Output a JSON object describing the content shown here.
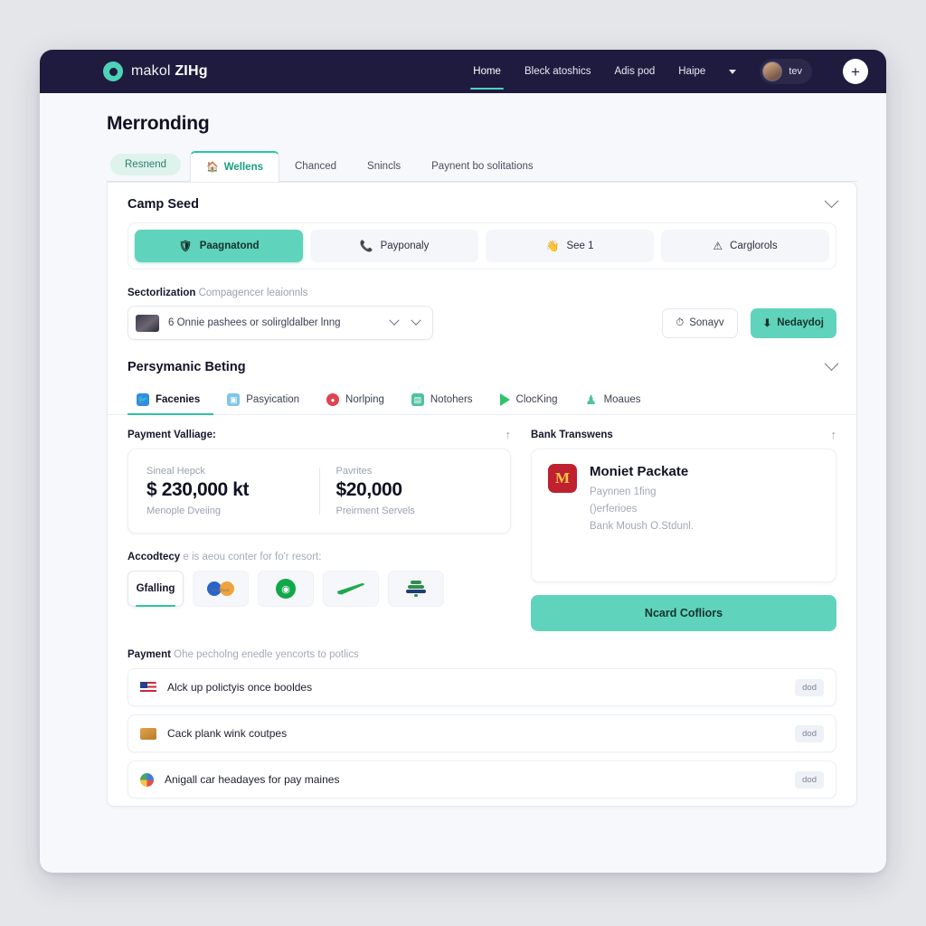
{
  "navbar": {
    "brand_light": "makol ",
    "brand_bold": "ZIHg",
    "links": [
      {
        "label": "Home",
        "active": true
      },
      {
        "label": "Bleck atoshics",
        "active": false
      },
      {
        "label": "Adis pod",
        "active": false
      },
      {
        "label": "Haipe",
        "active": false
      }
    ],
    "user_name": "tev",
    "add_label": "+"
  },
  "page": {
    "title": "Merronding",
    "pill_tab": "Resnend",
    "tabs": [
      {
        "label": "Wellens",
        "active": true
      },
      {
        "label": "Chanced",
        "active": false
      },
      {
        "label": "Snincls",
        "active": false
      },
      {
        "label": "Paynent bo solitations",
        "active": false
      }
    ]
  },
  "camp_section": {
    "title": "Camp Seed",
    "segments": [
      {
        "label": "Paagnatond",
        "icon": "shield-icon",
        "active": true
      },
      {
        "label": "Payponaly",
        "icon": "phone-icon",
        "active": false
      },
      {
        "label": "See 1",
        "icon": "hand-icon",
        "active": false
      },
      {
        "label": "Carglorols",
        "icon": "warning-icon",
        "active": false
      }
    ]
  },
  "sectorization": {
    "label": "Sectorlization",
    "hint": "Compagencer leaionnls",
    "select_value": "6 Onnie pashees or solirgldalber lnng",
    "buttons": [
      {
        "label": "Sonayv",
        "icon": "clock-icon",
        "style": "ghost"
      },
      {
        "label": "Nedaydoj",
        "icon": "download-icon",
        "style": "primary"
      }
    ]
  },
  "persymanic": {
    "title": "Persymanic Beting",
    "subtabs": [
      {
        "label": "Facenies",
        "icon": "twitter-icon",
        "color": "#2f8fe0",
        "shape": "square",
        "glyph": "✈",
        "active": true
      },
      {
        "label": "Pasyication",
        "icon": "photo-icon",
        "color": "#7ec6e8",
        "shape": "square",
        "glyph": "▣",
        "active": false
      },
      {
        "label": "Norlping",
        "icon": "record-icon",
        "color": "#e0434f",
        "shape": "circle",
        "glyph": "●",
        "active": false
      },
      {
        "label": "Notohers",
        "icon": "notes-icon",
        "color": "#4fc2a0",
        "shape": "square",
        "glyph": "▤",
        "active": false
      },
      {
        "label": "ClocKing",
        "icon": "play-icon",
        "color": "#2ec46d",
        "shape": "triangle",
        "glyph": "",
        "active": false
      },
      {
        "label": "Moaues",
        "icon": "person-icon",
        "color": "#4fc2a0",
        "shape": "person",
        "glyph": "♟",
        "active": false
      }
    ]
  },
  "payment_value": {
    "heading": "Payment Valliage:",
    "left": {
      "caption": "Sineal Hepck",
      "value": "$ 230,000 kt",
      "sub": "Menople Dveiing"
    },
    "right": {
      "caption": "Pavrites",
      "value": "$20,000",
      "sub": "Preirment Servels"
    }
  },
  "bank_transfer": {
    "heading": "Bank Transwens",
    "logo_letter": "M",
    "name": "Moniet Packate",
    "lines": [
      "Paynnen 1fing",
      "()erferioes",
      "Bank Moush O.Stdunl."
    ],
    "cta_label": "Ncard Cofliors"
  },
  "methods": {
    "label": "Accodtecy",
    "hint": "e is aeou conter for fo'r resort:",
    "items": [
      {
        "label": "Gfalling",
        "type": "text",
        "active": true
      },
      {
        "label": "",
        "type": "dual-circle-card",
        "caption": "bstdfous",
        "active": false
      },
      {
        "label": "",
        "type": "green-badge",
        "active": false
      },
      {
        "label": "",
        "type": "swoosh",
        "active": false
      },
      {
        "label": "",
        "type": "stack",
        "active": false
      }
    ]
  },
  "payment_list": {
    "label": "Payment",
    "hint": "Ohe pecholng enedle yencorts to potlics",
    "rows": [
      {
        "icon": "flag-icon",
        "text": "Alck up polictyis once booldes",
        "chip": "dod"
      },
      {
        "icon": "box-icon",
        "text": "Cack plank wink coutpes",
        "chip": "dod"
      },
      {
        "icon": "sphere-icon",
        "text": "Anigall car headayes for pay maines",
        "chip": "dod"
      }
    ]
  },
  "colors": {
    "accent_teal": "#5fd3bb",
    "accent_green": "#2ec4a3",
    "navbar_navy": "#1e1b3f",
    "page_bg": "#f7f8fb",
    "outer_bg": "#e4e6ea"
  }
}
